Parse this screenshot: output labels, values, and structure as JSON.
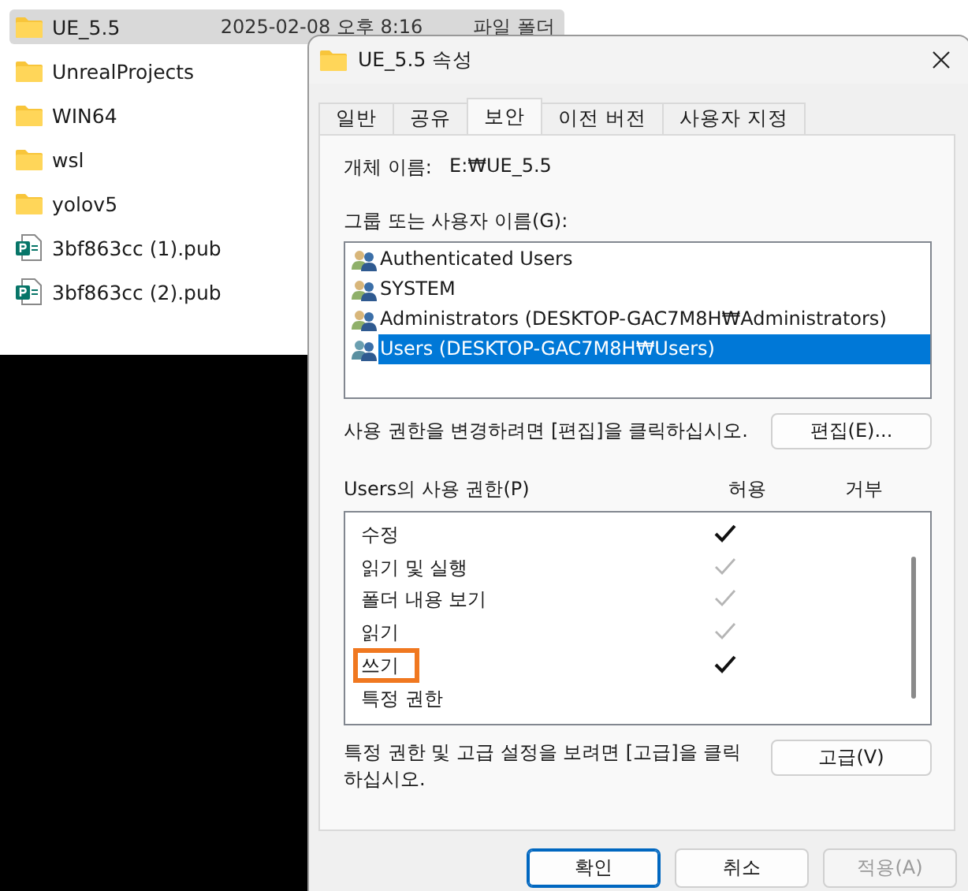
{
  "explorer": {
    "files": [
      {
        "name": "UE_5.5",
        "kind": "folder",
        "selected": true,
        "date": "2025-02-08 오후 8:16",
        "kind_label": "파일 폴더"
      },
      {
        "name": "UnrealProjects",
        "kind": "folder",
        "selected": false
      },
      {
        "name": "WIN64",
        "kind": "folder",
        "selected": false
      },
      {
        "name": "wsl",
        "kind": "folder",
        "selected": false
      },
      {
        "name": "yolov5",
        "kind": "folder",
        "selected": false
      },
      {
        "name": "3bf863cc (1).pub",
        "kind": "pub",
        "selected": false
      },
      {
        "name": "3bf863cc (2).pub",
        "kind": "pub",
        "selected": false
      }
    ]
  },
  "dialog": {
    "title": "UE_5.5 속성",
    "tabs": [
      {
        "label": "일반",
        "selected": false
      },
      {
        "label": "공유",
        "selected": false
      },
      {
        "label": "보안",
        "selected": true
      },
      {
        "label": "이전 버전",
        "selected": false
      },
      {
        "label": "사용자 지정",
        "selected": false
      }
    ],
    "object_name_label": "개체 이름:",
    "object_name": "E:₩UE_5.5",
    "group_label": "그룹 또는 사용자 이름(G):",
    "users": [
      {
        "name": "Authenticated Users",
        "selected": false
      },
      {
        "name": "SYSTEM",
        "selected": false
      },
      {
        "name": "Administrators (DESKTOP-GAC7M8H₩Administrators)",
        "selected": false
      },
      {
        "name": "Users (DESKTOP-GAC7M8H₩Users)",
        "selected": true
      }
    ],
    "edit_hint": "사용 권한을 변경하려면 [편집]을 클릭하십시오.",
    "edit_button": "편집(E)...",
    "permissions_label": "Users의 사용 권한(P)",
    "allow_header": "허용",
    "deny_header": "거부",
    "permissions": [
      {
        "name": "수정",
        "allowed": true,
        "inherited": false,
        "denied": false,
        "highlighted": false
      },
      {
        "name": "읽기 및 실행",
        "allowed": true,
        "inherited": true,
        "denied": false,
        "highlighted": false
      },
      {
        "name": "폴더 내용 보기",
        "allowed": true,
        "inherited": true,
        "denied": false,
        "highlighted": false
      },
      {
        "name": "읽기",
        "allowed": true,
        "inherited": true,
        "denied": false,
        "highlighted": false
      },
      {
        "name": "쓰기",
        "allowed": true,
        "inherited": false,
        "denied": false,
        "highlighted": true
      },
      {
        "name": "특정 권한",
        "allowed": false,
        "denied": false,
        "highlighted": false
      }
    ],
    "advanced_hint": "특정 권한 및 고급 설정을 보려면 [고급]을 클릭하십시오.",
    "advanced_button": "고급(V)",
    "buttons": [
      {
        "label": "확인",
        "kind": "default",
        "disabled": false
      },
      {
        "label": "취소",
        "kind": "normal",
        "disabled": false
      },
      {
        "label": "적용(A)",
        "kind": "normal",
        "disabled": true
      }
    ]
  }
}
